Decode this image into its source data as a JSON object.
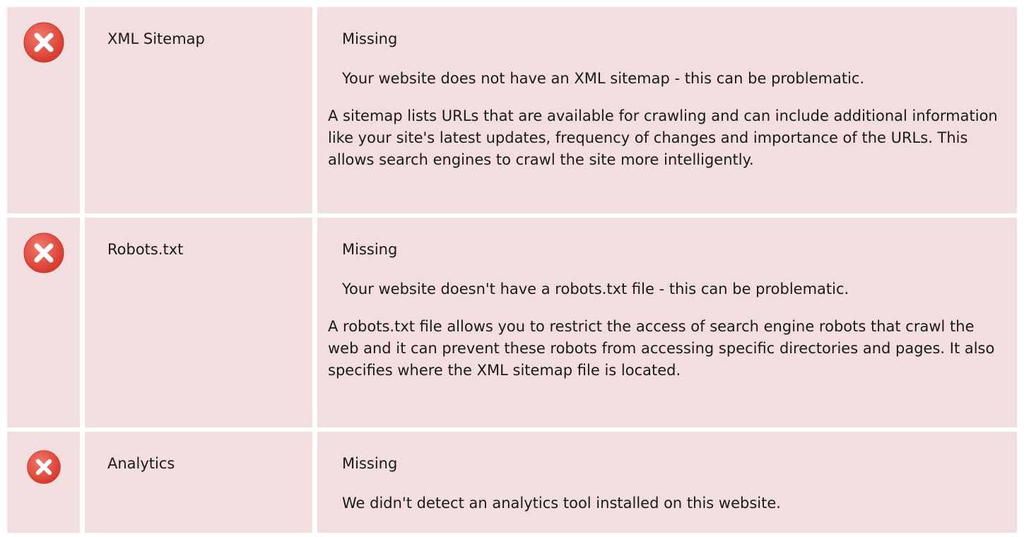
{
  "colors": {
    "row_background": "#f2dede",
    "error_icon": "#e0463a"
  },
  "rows": [
    {
      "icon": "error-x-icon",
      "name": "XML Sitemap",
      "status": "Missing",
      "message": "Your website does not have an XML sitemap - this can be problematic.",
      "description": "A sitemap lists URLs that are available for crawling and can include additional information like your site's latest updates, frequency of changes and importance of the URLs. This allows search engines to crawl the site more intelligently."
    },
    {
      "icon": "error-x-icon",
      "name": "Robots.txt",
      "status": "Missing",
      "message": "Your website doesn't have a robots.txt file - this can be problematic.",
      "description": "A robots.txt file allows you to restrict the access of search engine robots that crawl the web and it can prevent these robots from accessing specific directories and pages. It also specifies where the XML sitemap file is located."
    },
    {
      "icon": "error-x-icon",
      "name": "Analytics",
      "status": "Missing",
      "message": "We didn't detect an analytics tool installed on this website."
    }
  ]
}
